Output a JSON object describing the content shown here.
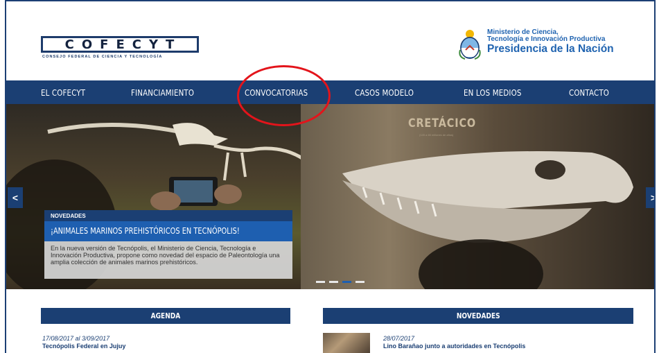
{
  "header": {
    "logo_text": "COFECYT",
    "logo_subtitle": "CONSEJO FEDERAL DE CIENCIA Y TECNOLOGÍA",
    "ministry_line1": "Ministerio de Ciencia,",
    "ministry_line2": "Tecnología e Innovación Productiva",
    "ministry_line3": "Presidencia de la Nación"
  },
  "nav": {
    "items": [
      {
        "label": "EL COFECYT"
      },
      {
        "label": "FINANCIAMIENTO"
      },
      {
        "label": "CONVOCATORIAS"
      },
      {
        "label": "CASOS MODELO"
      },
      {
        "label": "EN LOS MEDIOS"
      },
      {
        "label": "CONTACTO"
      }
    ]
  },
  "hero": {
    "wall_sign": "CRETÁCICO",
    "wall_sign_sub": "(145 a 65 millones de años)",
    "prev_arrow": "<",
    "next_arrow": ">",
    "caption_tag": "NOVEDADES",
    "caption_title": "¡ANIMALES MARINOS PREHISTÓRICOS EN TECNÓPOLIS!",
    "caption_body": "En la nueva versión de Tecnópolis, el Ministerio de Ciencia, Tecnología e Innovación Productiva, propone como novedad del espacio de Paleontología una amplia colección de animales marinos prehistóricos.",
    "slide_count": 4,
    "active_slide": 3
  },
  "agenda": {
    "heading": "AGENDA",
    "items": [
      {
        "date": "17/08/2017 al 3/09/2017",
        "title": "Tecnópolis Federal en Jujuy"
      }
    ]
  },
  "novedades": {
    "heading": "NOVEDADES",
    "items": [
      {
        "date": "28/07/2017",
        "title": "Lino Barañao junto a autoridades en Tecnópolis"
      }
    ]
  },
  "colors": {
    "nav_bg": "#1b3f73",
    "accent_blue": "#1e5fb0",
    "highlight_circle": "#e3141b"
  }
}
